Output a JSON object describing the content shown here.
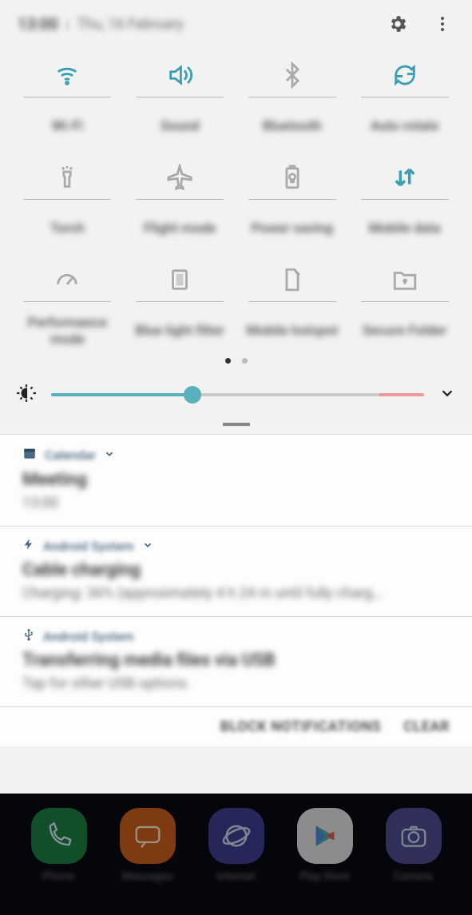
{
  "status": {
    "time": "13:00",
    "date": "Thu, 16 February"
  },
  "qs": [
    {
      "id": "wifi",
      "label": "Wi-Fi",
      "active": true
    },
    {
      "id": "sound",
      "label": "Sound",
      "active": true
    },
    {
      "id": "bluetooth",
      "label": "Bluetooth",
      "active": false
    },
    {
      "id": "autorotate",
      "label": "Auto rotate",
      "active": true
    },
    {
      "id": "torch",
      "label": "Torch",
      "active": false
    },
    {
      "id": "flight",
      "label": "Flight mode",
      "active": false
    },
    {
      "id": "power",
      "label": "Power saving",
      "active": false
    },
    {
      "id": "mobiledata",
      "label": "Mobile data",
      "active": true
    },
    {
      "id": "performance",
      "label": "Performance mode",
      "active": false
    },
    {
      "id": "bluelight",
      "label": "Blue light filter",
      "active": false
    },
    {
      "id": "hotspot",
      "label": "Mobile hotspot",
      "active": false
    },
    {
      "id": "secure",
      "label": "Secure Folder",
      "active": false
    }
  ],
  "brightness": {
    "percent": 38
  },
  "notifications": [
    {
      "icon": "calendar",
      "app": "Calendar",
      "expandable": true,
      "title": "Meeting",
      "sub": "13:00"
    },
    {
      "icon": "bolt",
      "app": "Android System",
      "expandable": true,
      "title": "Cable charging",
      "sub": "Charging: 36% (approximately 4 h 24 m until fully charg…"
    },
    {
      "icon": "usb",
      "app": "Android System",
      "expandable": false,
      "title": "Transferring media files via USB",
      "sub": "Tap for other USB options."
    }
  ],
  "actions": {
    "block": "BLOCK NOTIFICATIONS",
    "clear": "CLEAR"
  },
  "dock": [
    {
      "id": "phone",
      "label": "Phone",
      "color": "c-green"
    },
    {
      "id": "messages",
      "label": "Messages",
      "color": "c-orange"
    },
    {
      "id": "internet",
      "label": "Internet",
      "color": "c-blue"
    },
    {
      "id": "play",
      "label": "Play Store",
      "color": "c-white"
    },
    {
      "id": "camera",
      "label": "Camera",
      "color": "c-indigo"
    }
  ],
  "colors": {
    "accent": "#3a9fb5",
    "inactive": "#aaaaaa"
  }
}
